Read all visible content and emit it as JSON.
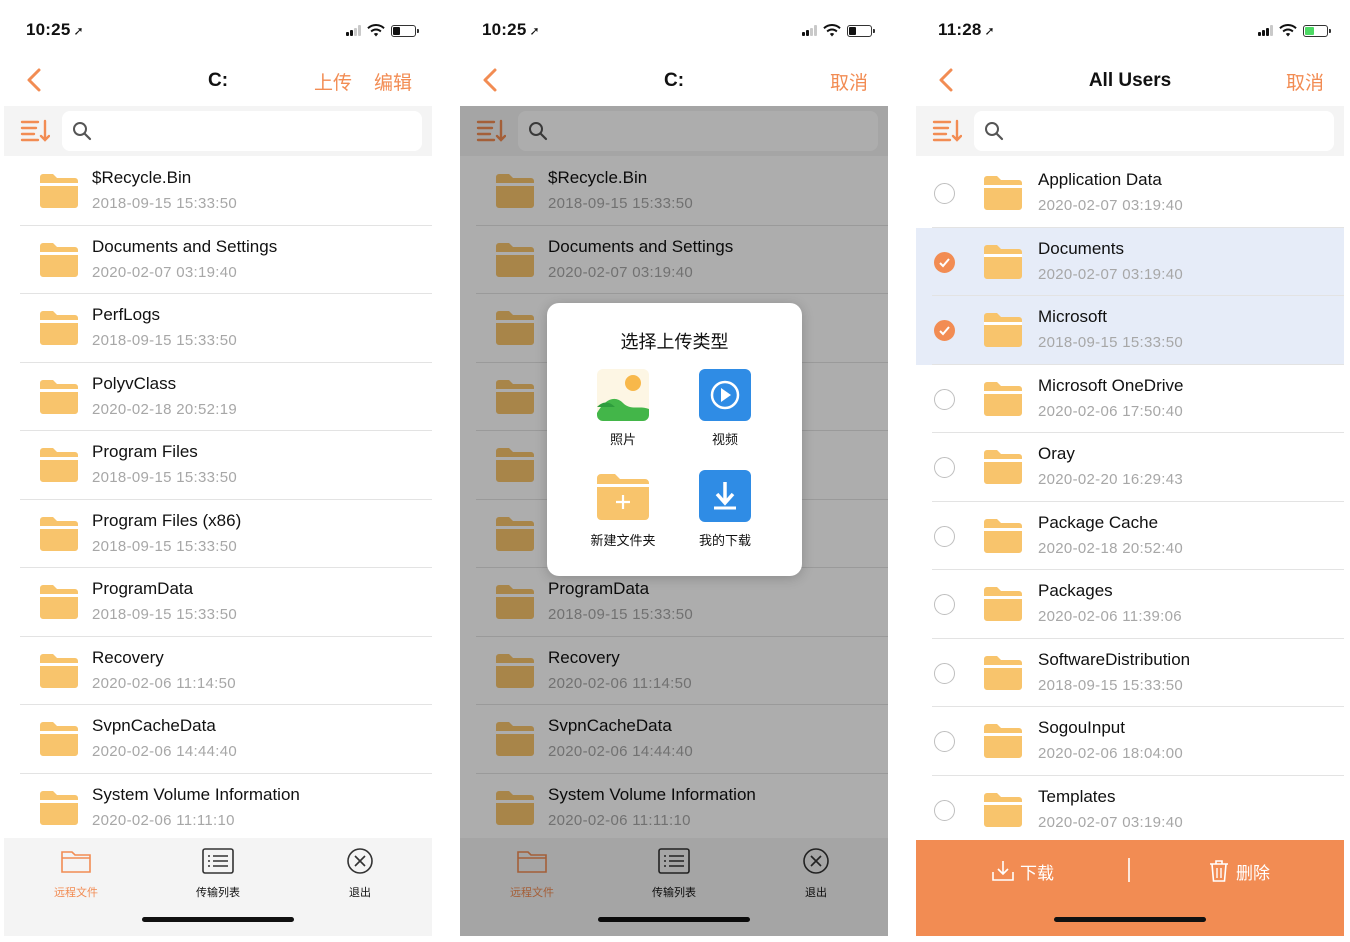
{
  "colors": {
    "accent": "#f28c53",
    "folder": "#f8c46c",
    "selected_row": "#e6ecf8"
  },
  "screen1": {
    "time": "10:25",
    "title": "C:",
    "nav_buttons": [
      "上传",
      "编辑"
    ],
    "search_placeholder": "",
    "items": [
      {
        "name": "$Recycle.Bin",
        "date": "2018-09-15 15:33:50"
      },
      {
        "name": "Documents and Settings",
        "date": "2020-02-07 03:19:40"
      },
      {
        "name": "PerfLogs",
        "date": "2018-09-15 15:33:50"
      },
      {
        "name": "PolyvClass",
        "date": "2020-02-18 20:52:19"
      },
      {
        "name": "Program Files",
        "date": "2018-09-15 15:33:50"
      },
      {
        "name": "Program Files (x86)",
        "date": "2018-09-15 15:33:50"
      },
      {
        "name": "ProgramData",
        "date": "2018-09-15 15:33:50"
      },
      {
        "name": "Recovery",
        "date": "2020-02-06 11:14:50"
      },
      {
        "name": "SvpnCacheData",
        "date": "2020-02-06 14:44:40"
      },
      {
        "name": "System Volume Information",
        "date": "2020-02-06 11:11:10"
      }
    ],
    "tabs": [
      {
        "label": "远程文件",
        "icon": "folder-icon",
        "active": true
      },
      {
        "label": "传输列表",
        "icon": "list-icon",
        "active": false
      },
      {
        "label": "退出",
        "icon": "close-circle-icon",
        "active": false
      }
    ]
  },
  "screen2": {
    "time": "10:25",
    "title": "C:",
    "nav_button": "取消",
    "items": [
      {
        "name": "$Recycle.Bin",
        "date": "2018-09-15 15:33:50"
      },
      {
        "name": "Documents and Settings",
        "date": "2020-02-07 03:19:40"
      },
      {
        "name": "",
        "date": ""
      },
      {
        "name": "",
        "date": ""
      },
      {
        "name": "",
        "date": ""
      },
      {
        "name": "",
        "date": ""
      },
      {
        "name": "ProgramData",
        "date": "2018-09-15 15:33:50"
      },
      {
        "name": "Recovery",
        "date": "2020-02-06 11:14:50"
      },
      {
        "name": "SvpnCacheData",
        "date": "2020-02-06 14:44:40"
      },
      {
        "name": "System Volume Information",
        "date": "2020-02-06 11:11:10"
      }
    ],
    "modal": {
      "title": "选择上传类型",
      "options": [
        {
          "label": "照片",
          "icon": "photo-icon"
        },
        {
          "label": "视频",
          "icon": "video-icon"
        },
        {
          "label": "新建文件夹",
          "icon": "new-folder-icon"
        },
        {
          "label": "我的下载",
          "icon": "download-icon"
        }
      ]
    },
    "tabs": [
      {
        "label": "远程文件",
        "icon": "folder-icon",
        "active": true
      },
      {
        "label": "传输列表",
        "icon": "list-icon",
        "active": false
      },
      {
        "label": "退出",
        "icon": "close-circle-icon",
        "active": false
      }
    ]
  },
  "screen3": {
    "time": "11:28",
    "title": "All Users",
    "nav_button": "取消",
    "items": [
      {
        "name": "Application Data",
        "date": "2020-02-07 03:19:40",
        "selected": false
      },
      {
        "name": "Documents",
        "date": "2020-02-07 03:19:40",
        "selected": true
      },
      {
        "name": "Microsoft",
        "date": "2018-09-15 15:33:50",
        "selected": true
      },
      {
        "name": "Microsoft OneDrive",
        "date": "2020-02-06 17:50:40",
        "selected": false
      },
      {
        "name": "Oray",
        "date": "2020-02-20 16:29:43",
        "selected": false
      },
      {
        "name": "Package Cache",
        "date": "2020-02-18 20:52:40",
        "selected": false
      },
      {
        "name": "Packages",
        "date": "2020-02-06 11:39:06",
        "selected": false
      },
      {
        "name": "SoftwareDistribution",
        "date": "2018-09-15 15:33:50",
        "selected": false
      },
      {
        "name": "SogouInput",
        "date": "2020-02-06 18:04:00",
        "selected": false
      },
      {
        "name": "Templates",
        "date": "2020-02-07 03:19:40",
        "selected": false
      }
    ],
    "actions": [
      {
        "label": "下载",
        "icon": "download-tray-icon"
      },
      {
        "label": "删除",
        "icon": "trash-icon"
      }
    ]
  }
}
